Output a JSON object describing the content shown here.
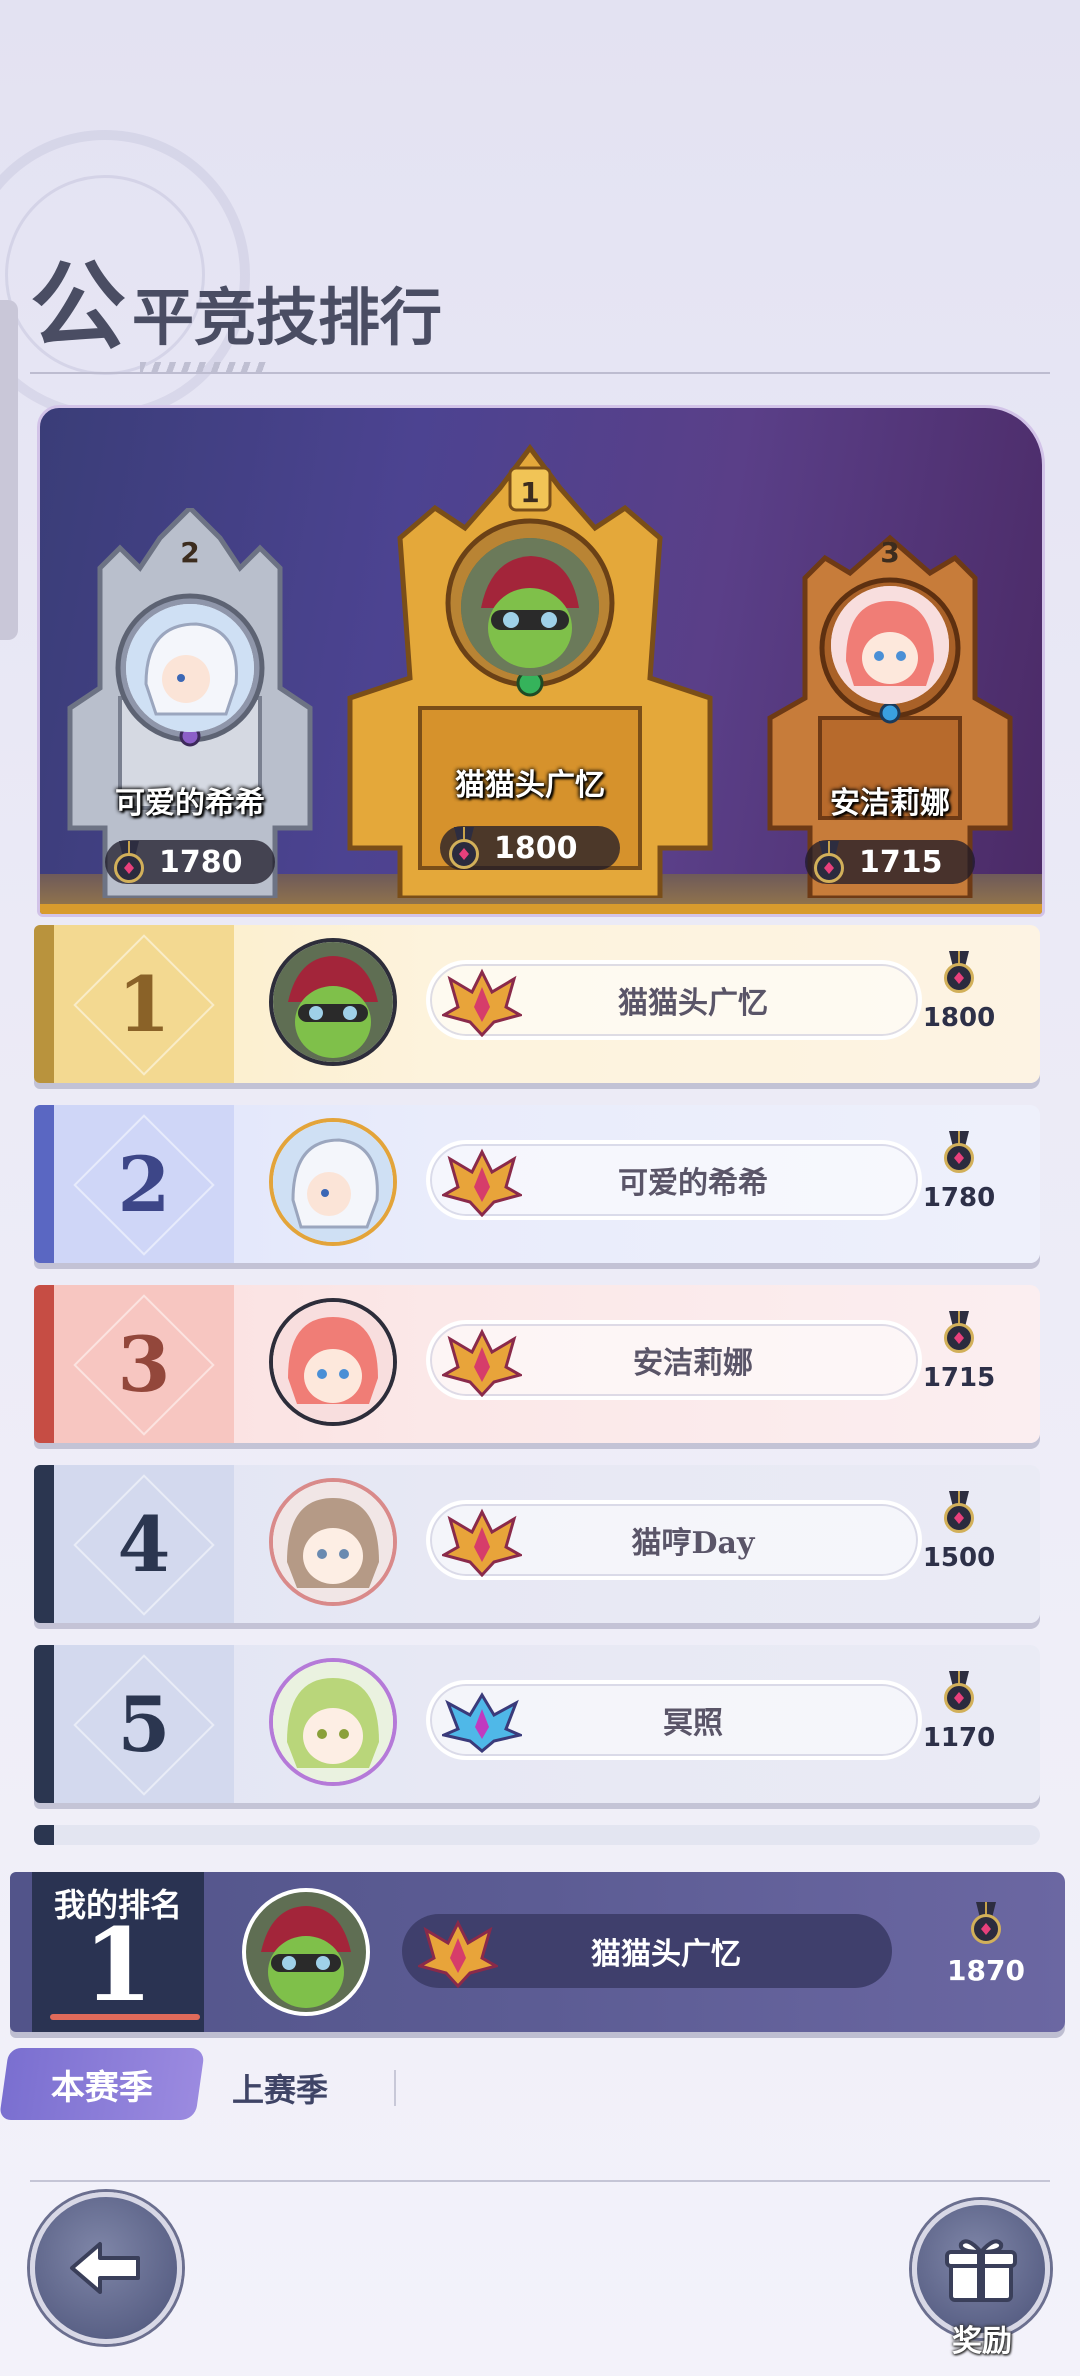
{
  "header": {
    "title_big": "公",
    "title_rest": "平竞技排行"
  },
  "podium": [
    {
      "rank": "2",
      "name": "可爱的希希",
      "score": "1780"
    },
    {
      "rank": "1",
      "name": "猫猫头广忆",
      "score": "1800"
    },
    {
      "rank": "3",
      "name": "安洁莉娜",
      "score": "1715"
    }
  ],
  "ranking": [
    {
      "rank": "1",
      "name": "猫猫头广忆",
      "score": "1800"
    },
    {
      "rank": "2",
      "name": "可爱的希希",
      "score": "1780"
    },
    {
      "rank": "3",
      "name": "安洁莉娜",
      "score": "1715"
    },
    {
      "rank": "4",
      "name": "猫哼Day",
      "score": "1500"
    },
    {
      "rank": "5",
      "name": "冥照",
      "score": "1170"
    }
  ],
  "my_rank": {
    "label": "我的排名",
    "rank": "1",
    "name": "猫猫头广忆",
    "score": "1870"
  },
  "tabs": {
    "active": "本赛季",
    "inactive": "上赛季"
  },
  "buttons": {
    "back_icon": "back-arrow-icon",
    "reward_label": "奖励"
  },
  "colors": {
    "gold": "#b9933d",
    "silver": "#5a67c2",
    "bronze": "#c64d44",
    "default": "#2b3650",
    "my_rank_bg": "#52548a",
    "tab_active": "#7a6fd0"
  }
}
